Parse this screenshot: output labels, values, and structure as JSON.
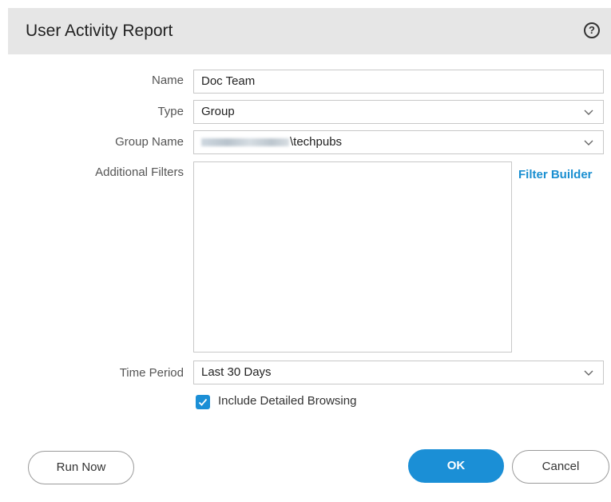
{
  "dialog": {
    "title": "User Activity Report",
    "help_icon": "help-circle-icon"
  },
  "form": {
    "name": {
      "label": "Name",
      "value": "Doc Team"
    },
    "type": {
      "label": "Type",
      "value": "Group"
    },
    "group_name": {
      "label": "Group Name",
      "value_suffix": "\\techpubs"
    },
    "additional_filters": {
      "label": "Additional Filters",
      "value": "",
      "link": "Filter Builder"
    },
    "time_period": {
      "label": "Time Period",
      "value": "Last 30 Days"
    },
    "include_detailed_browsing": {
      "label": "Include Detailed Browsing",
      "checked": true
    }
  },
  "buttons": {
    "run_now": "Run Now",
    "ok": "OK",
    "cancel": "Cancel"
  },
  "colors": {
    "accent": "#1b8fd6",
    "titlebar": "#e6e6e6"
  }
}
